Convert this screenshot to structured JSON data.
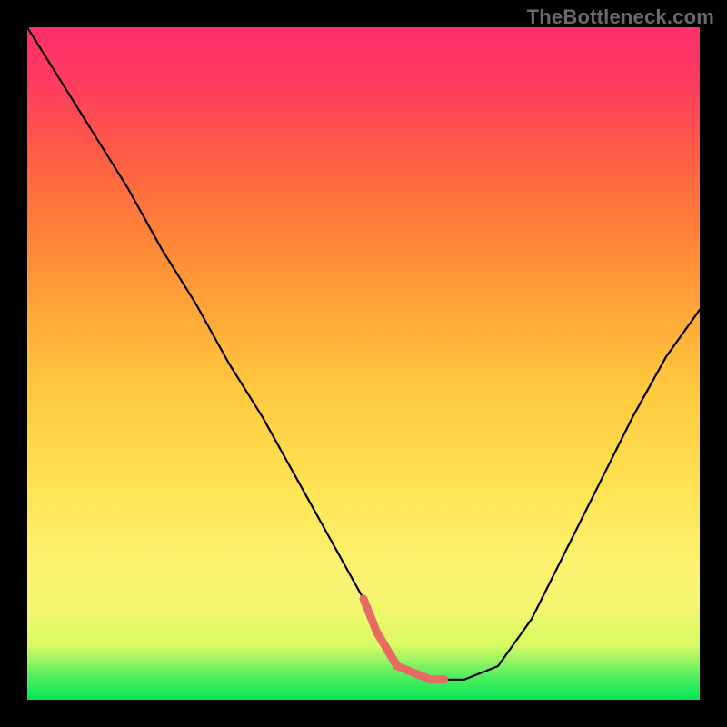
{
  "watermark": "TheBottleneck.com",
  "colors": {
    "frame_bg": "#000000",
    "curve_stroke": "#000000",
    "accent_zone": "#e96a63",
    "gradient_stops": [
      "#00e756",
      "#60f060",
      "#d7fa62",
      "#f6f770",
      "#fdf270",
      "#ffe252",
      "#ffc93e",
      "#ffa638",
      "#ff8038",
      "#ff5a46",
      "#ff3b60",
      "#ff2f6a"
    ]
  },
  "chart_data": {
    "type": "line",
    "title": "",
    "xlabel": "",
    "ylabel": "",
    "xlim": [
      0,
      100
    ],
    "ylim": [
      0,
      100
    ],
    "grid": false,
    "legend": false,
    "series": [
      {
        "name": "bottleneck-curve",
        "x": [
          0,
          5,
          10,
          15,
          20,
          25,
          30,
          35,
          40,
          45,
          50,
          52,
          55,
          60,
          62,
          65,
          70,
          75,
          80,
          85,
          90,
          95,
          100
        ],
        "values": [
          100,
          92,
          84,
          76,
          67,
          59,
          50,
          42,
          33,
          24,
          15,
          10,
          5,
          3,
          3,
          3,
          5,
          12,
          22,
          32,
          42,
          51,
          58
        ]
      }
    ],
    "annotations": [
      {
        "name": "optimal-zone",
        "x_range": [
          50,
          62
        ],
        "y": 3,
        "style": "accent-band"
      }
    ]
  }
}
